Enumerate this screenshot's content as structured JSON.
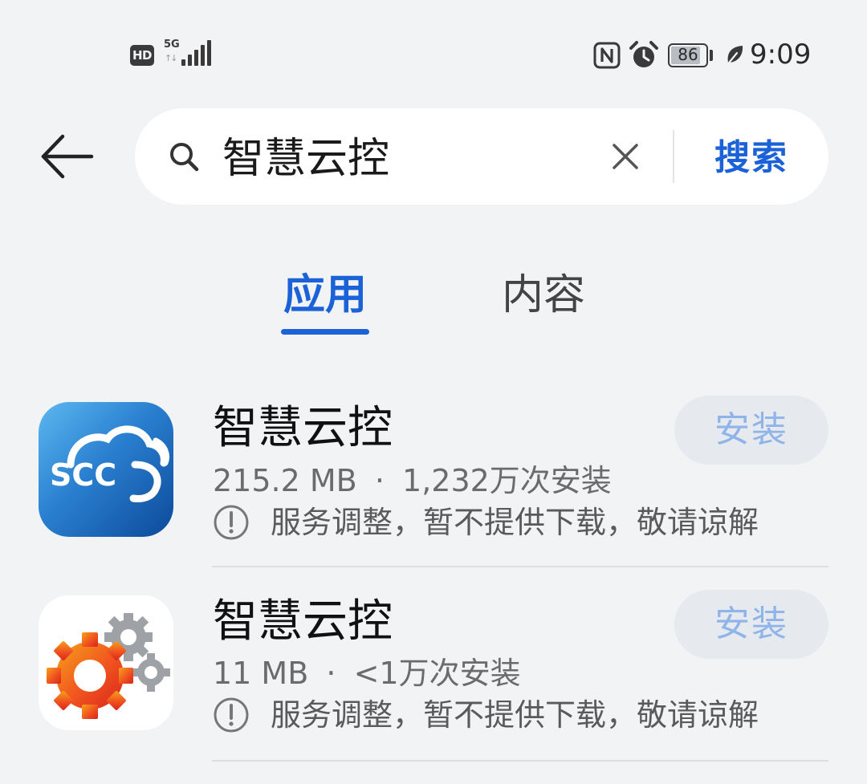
{
  "status_bar": {
    "hd_badge": "HD",
    "network": "5G",
    "battery_level": "86",
    "battery_fraction": 0.86,
    "time": "9:09",
    "icons": [
      "nfc-icon",
      "alarm-icon",
      "battery-icon",
      "leaf-icon"
    ]
  },
  "search": {
    "query": "智慧云控",
    "button_label": "搜索"
  },
  "tabs": [
    {
      "label": "应用",
      "active": true
    },
    {
      "label": "内容",
      "active": false
    }
  ],
  "results": [
    {
      "name": "智慧云控",
      "icon_text": "SCC",
      "size": "215.2 MB",
      "separator": "·",
      "installs": "1,232万次安装",
      "notice": "服务调整，暂不提供下载，敬请谅解",
      "install_label": "安装"
    },
    {
      "name": "智慧云控",
      "icon_text": "",
      "size": "11 MB",
      "separator": "·",
      "installs": "<1万次安装",
      "notice": "服务调整，暂不提供下载，敬请谅解",
      "install_label": "安装"
    }
  ],
  "colors": {
    "accent": "#1b62d8",
    "install_text_disabled": "#8fb4ea",
    "background": "#f1f3f5"
  }
}
